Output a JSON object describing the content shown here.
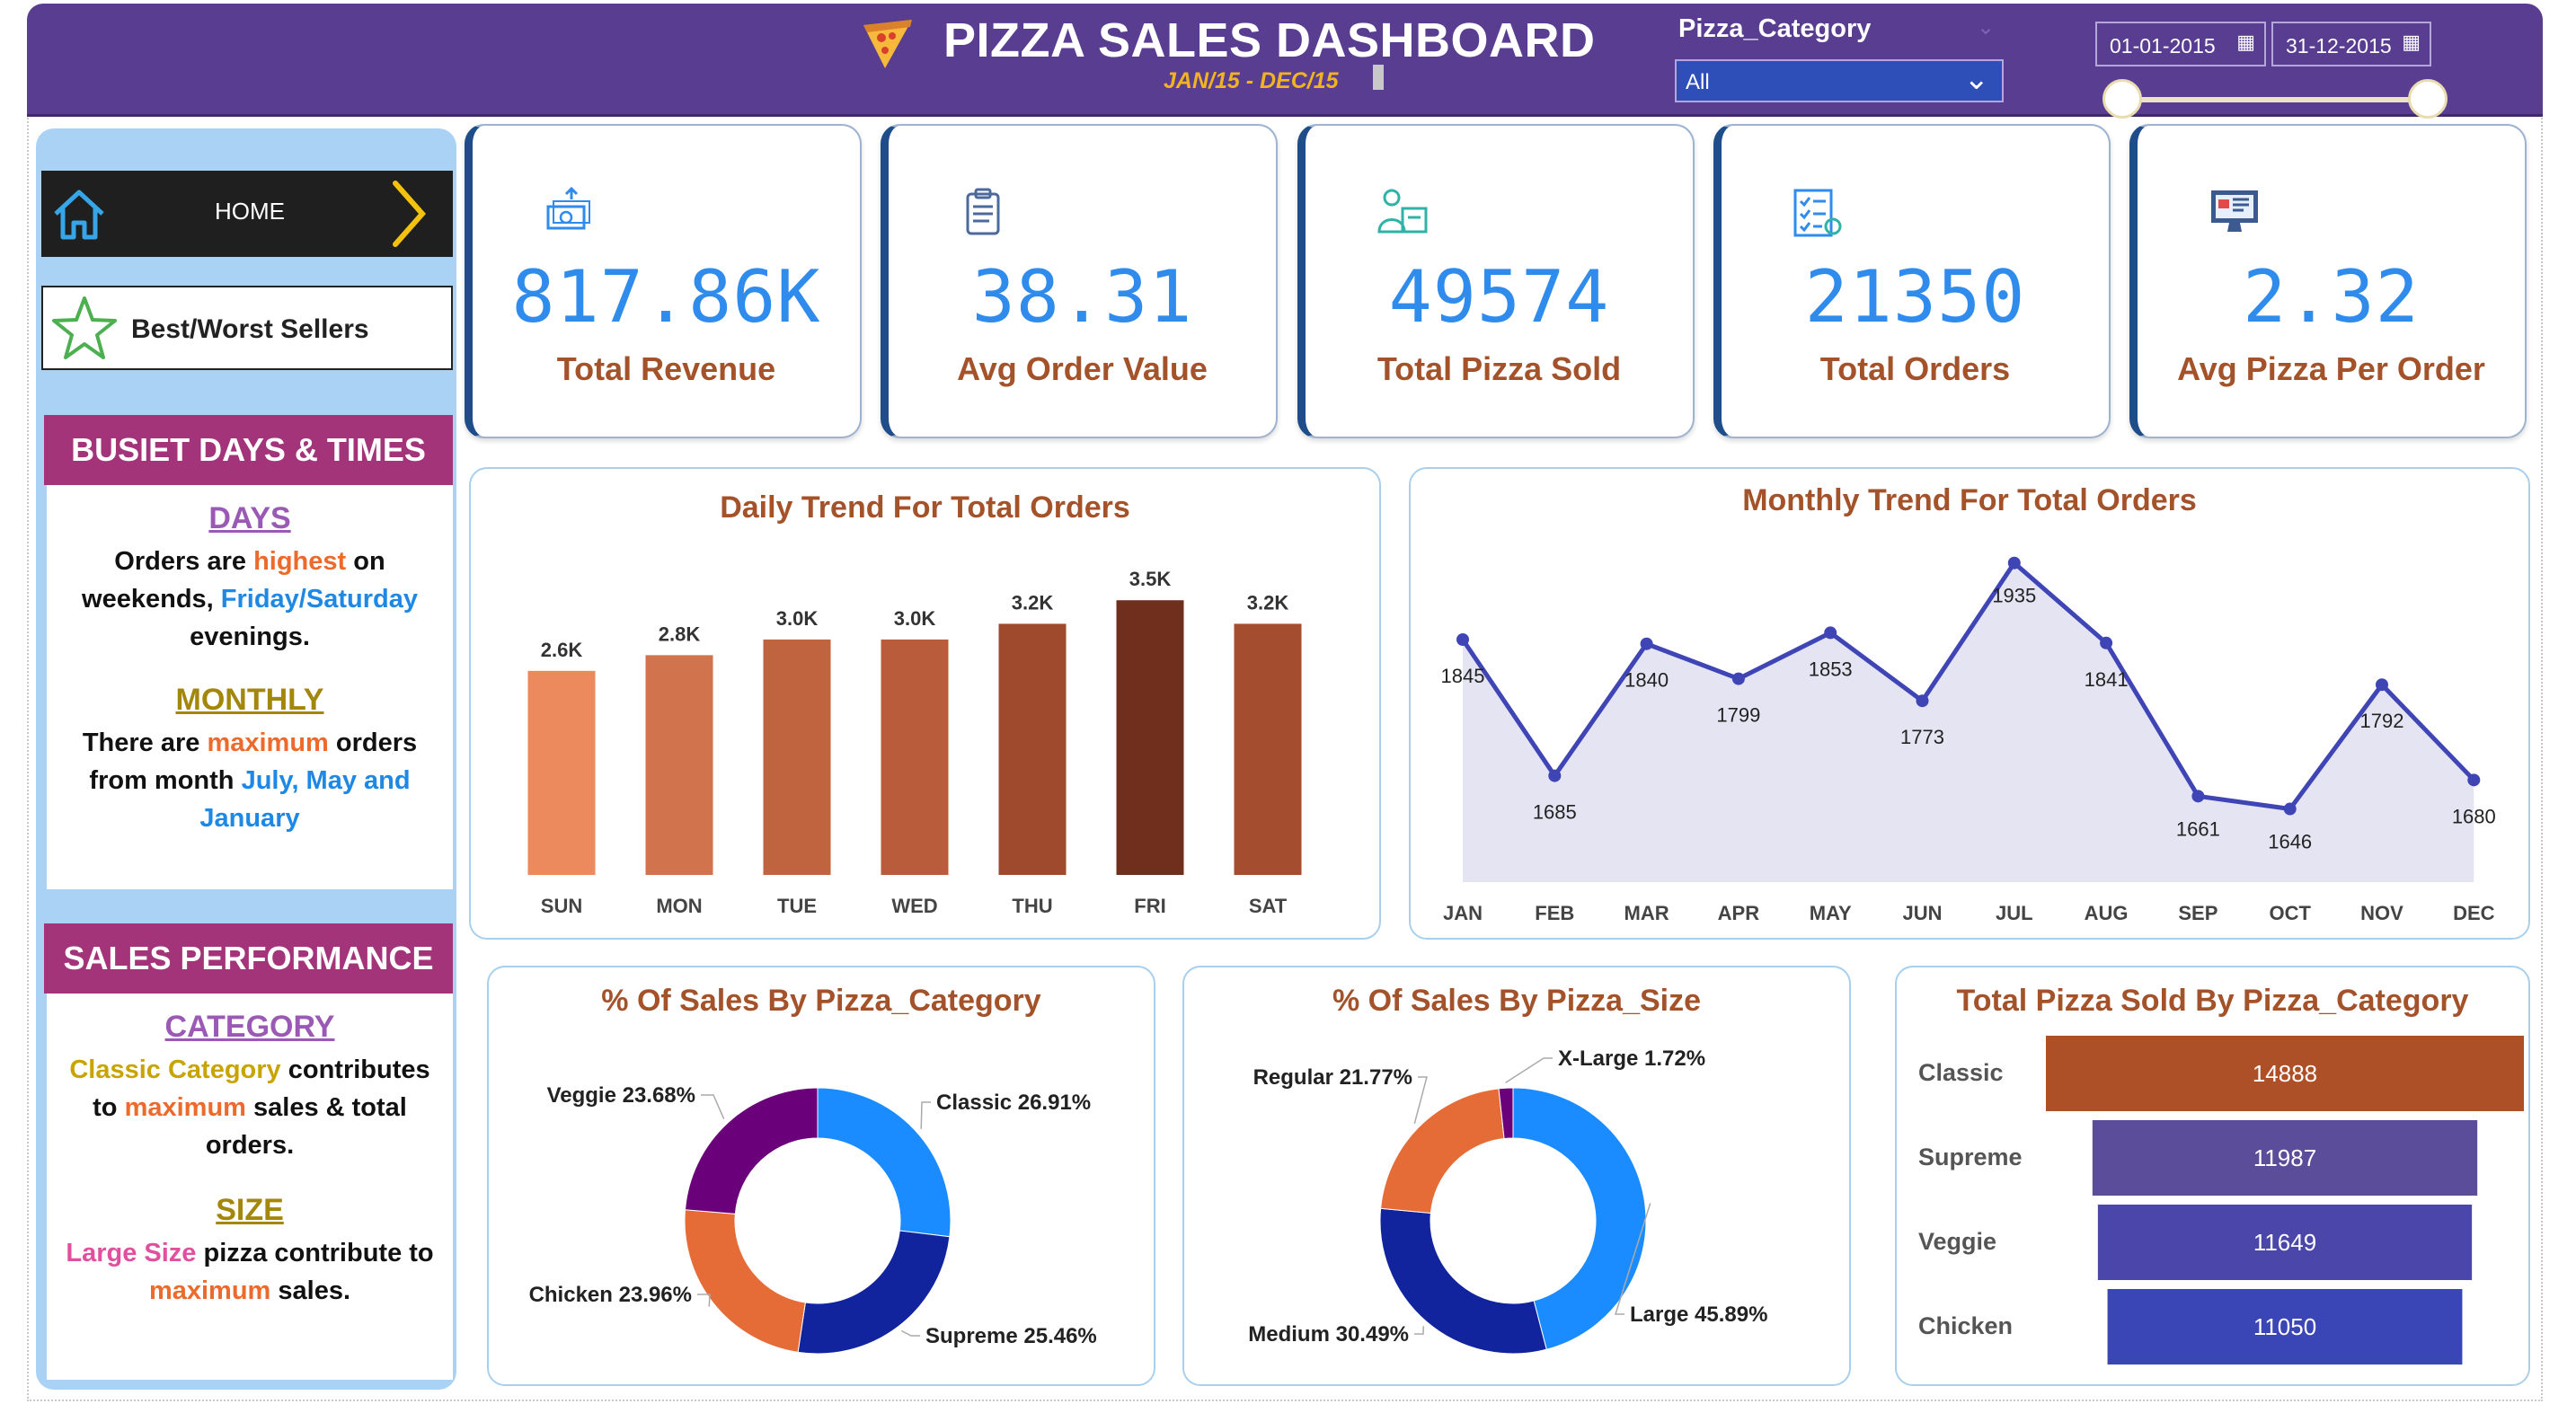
{
  "header": {
    "title": "PIZZA SALES DASHBOARD",
    "subtitle": "JAN/15 - DEC/15",
    "filter_label": "Pizza_Category",
    "filter_value": "All",
    "date_start": "01-01-2015",
    "date_end": "31-12-2015"
  },
  "sidebar": {
    "home_label": "HOME",
    "best_worst_label": "Best/Worst Sellers",
    "busiest": {
      "heading": "BUSIET DAYS & TIMES",
      "days_title": "DAYS",
      "days_l1a": "Orders are ",
      "days_l1b": "highest",
      "days_l1c": " on",
      "days_l2a": "weekends, ",
      "days_l2b": "Friday/Saturday",
      "days_l3": "evenings.",
      "monthly_title": "MONTHLY",
      "monthly_l1a": "There are ",
      "monthly_l1b": "maximum",
      "monthly_l1c": " orders",
      "monthly_l2a": "from month ",
      "monthly_l2b": "July, May and",
      "monthly_l3": "January"
    },
    "performance": {
      "heading": "SALES PERFORMANCE",
      "category_title": "CATEGORY",
      "cat_l1a": "Classic Category",
      "cat_l1b": " contributes",
      "cat_l2a": "to ",
      "cat_l2b": "maximum",
      "cat_l2c": " sales & total",
      "cat_l3": "orders.",
      "size_title": "SIZE",
      "size_l1a": "Large Size",
      "size_l1b": " pizza contribute to",
      "size_l2a": "maximum",
      "size_l2b": " sales."
    }
  },
  "kpis": [
    {
      "value": "817.86K",
      "label": "Total Revenue",
      "icon": "money-icon"
    },
    {
      "value": "38.31",
      "label": "Avg Order Value",
      "icon": "clipboard-icon"
    },
    {
      "value": "49574",
      "label": "Total Pizza Sold",
      "icon": "delivery-icon"
    },
    {
      "value": "21350",
      "label": "Total Orders",
      "icon": "checklist-icon"
    },
    {
      "value": "2.32",
      "label": "Avg Pizza Per Order",
      "icon": "monitor-icon"
    }
  ],
  "colors": {
    "header_bg": "#583d91",
    "accent_title": "#a4522a",
    "kpi_value": "#2f8bec",
    "side_heading": "#a43479"
  },
  "chart_data": [
    {
      "type": "bar",
      "title": "Daily Trend For Total Orders",
      "categories": [
        "SUN",
        "MON",
        "TUE",
        "WED",
        "THU",
        "FRI",
        "SAT"
      ],
      "values": [
        2.6,
        2.8,
        3.0,
        3.0,
        3.2,
        3.5,
        3.2
      ],
      "value_labels": [
        "2.6K",
        "2.8K",
        "3.0K",
        "3.0K",
        "3.2K",
        "3.5K",
        "3.2K"
      ],
      "colors": [
        "#ec8a5e",
        "#d1734d",
        "#c0633f",
        "#b95c3c",
        "#9f4a2c",
        "#6f2f1c",
        "#a44d2f"
      ],
      "ylim": [
        0,
        3.8
      ],
      "grid": false
    },
    {
      "type": "area",
      "title": "Monthly Trend For Total Orders",
      "categories": [
        "JAN",
        "FEB",
        "MAR",
        "APR",
        "MAY",
        "JUN",
        "JUL",
        "AUG",
        "SEP",
        "OCT",
        "NOV",
        "DEC"
      ],
      "values": [
        1845,
        1685,
        1840,
        1799,
        1853,
        1773,
        1935,
        1841,
        1661,
        1646,
        1792,
        1680
      ],
      "ylim": [
        1560,
        1940
      ],
      "line_color": "#3f45b5",
      "fill_color": "#e4e4f3",
      "grid": false
    },
    {
      "type": "pie",
      "title": "% Of Sales By Pizza_Category",
      "labels": [
        "Classic",
        "Supreme",
        "Chicken",
        "Veggie"
      ],
      "values": [
        26.91,
        25.46,
        23.96,
        23.68
      ],
      "display": [
        "Classic 26.91%",
        "Supreme 25.46%",
        "Chicken 23.96%",
        "Veggie 23.68%"
      ],
      "colors": [
        "#1a8cff",
        "#12239e",
        "#e66c37",
        "#6b007b"
      ]
    },
    {
      "type": "pie",
      "title": "% Of Sales By Pizza_Size",
      "labels": [
        "Large",
        "Medium",
        "Regular",
        "X-Large"
      ],
      "values": [
        45.89,
        30.49,
        21.77,
        1.72
      ],
      "display": [
        "Large 45.89%",
        "Medium 30.49%",
        "Regular 21.77%",
        "X-Large 1.72%"
      ],
      "colors": [
        "#1a8cff",
        "#12239e",
        "#e66c37",
        "#6b007b"
      ]
    },
    {
      "type": "bar",
      "orientation": "horizontal-funnel",
      "title": "Total Pizza Sold By Pizza_Category",
      "categories": [
        "Classic",
        "Supreme",
        "Veggie",
        "Chicken"
      ],
      "values": [
        14888,
        11987,
        11649,
        11050
      ],
      "colors": [
        "#ad4f27",
        "#5c4d9a",
        "#4b47aa",
        "#3a45b6"
      ]
    }
  ]
}
